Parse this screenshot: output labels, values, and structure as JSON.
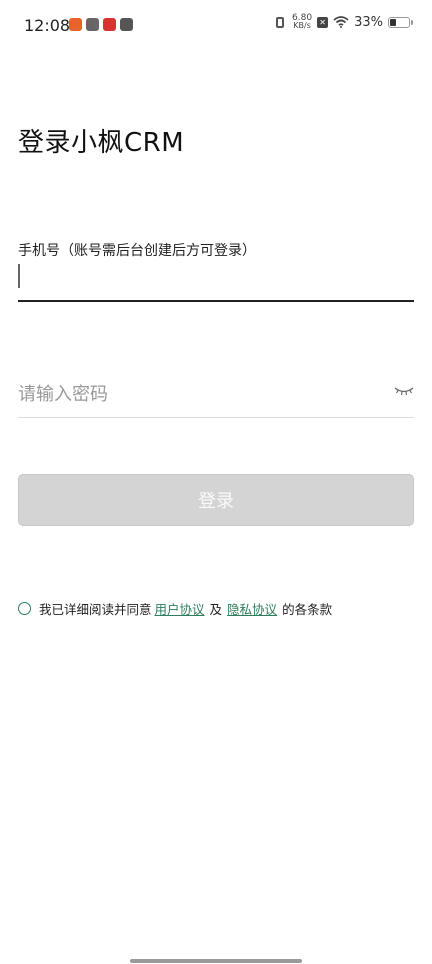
{
  "status_bar": {
    "time": "12:08",
    "net_speed_value": "6.80",
    "net_speed_unit": "KB/s",
    "battery_percent": "33%",
    "battery_level": 0.33,
    "icons": [
      "app-notification-icon",
      "app-notification-icon",
      "app-notification-icon",
      "app-notification-icon",
      "vibrate-icon",
      "no-sim-icon",
      "wifi-icon",
      "battery-icon"
    ]
  },
  "page": {
    "title": "登录小枫CRM"
  },
  "form": {
    "phone_label": "手机号（账号需后台创建后方可登录）",
    "phone_value": "",
    "password_placeholder": "请输入密码",
    "password_value": "",
    "login_button": "登录"
  },
  "agreement": {
    "prefix": "我已详细阅读并同意",
    "user_agreement": "用户协议",
    "and": "及",
    "privacy_agreement": "隐私协议",
    "suffix": "的各条款",
    "checked": false
  },
  "colors": {
    "link": "#2e7d5b",
    "button_disabled_bg": "#d4d4d4",
    "button_text": "#fafafa"
  }
}
